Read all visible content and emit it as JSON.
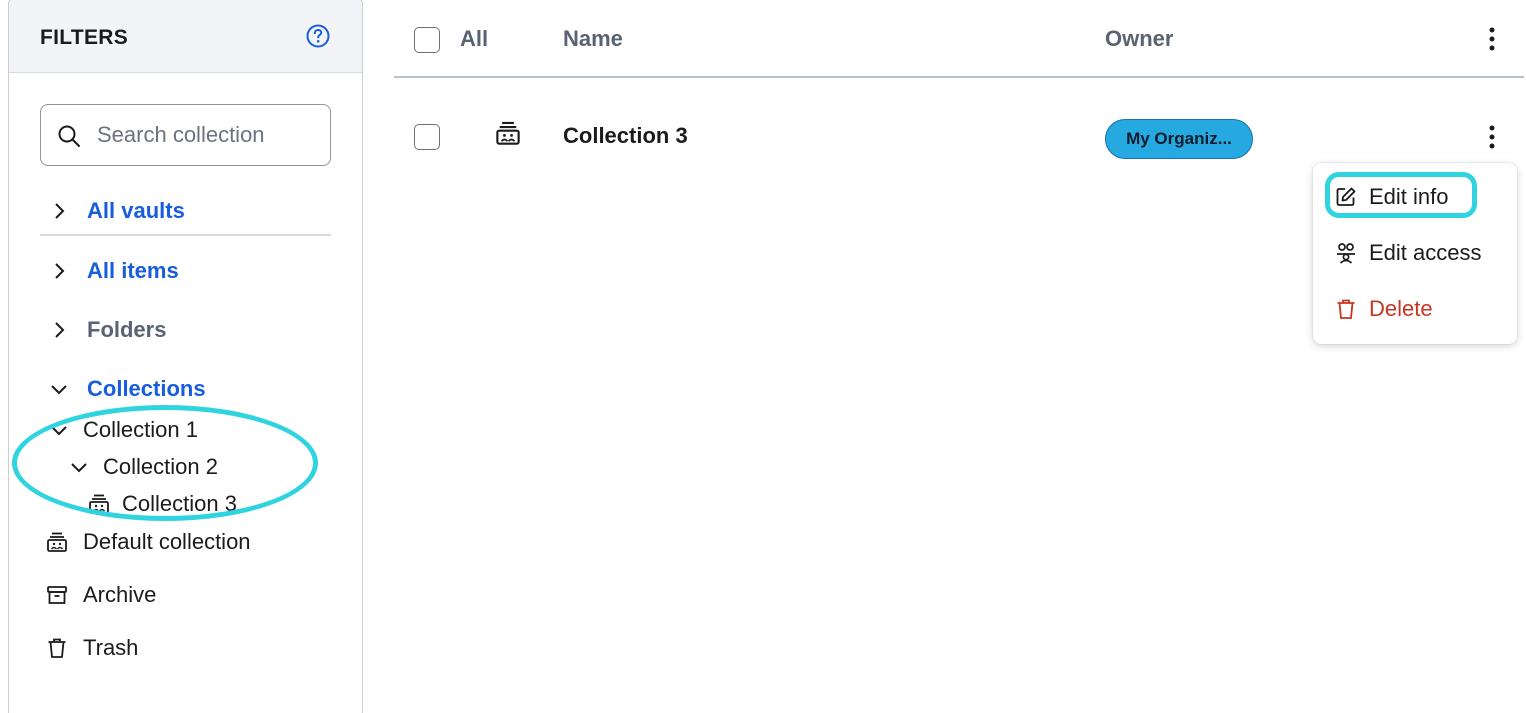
{
  "sidebar": {
    "title": "FILTERS",
    "search_placeholder": "Search collection",
    "nav": [
      {
        "label": "All vaults",
        "expanded": false
      },
      {
        "label": "All items",
        "expanded": false
      },
      {
        "label": "Folders",
        "expanded": false
      },
      {
        "label": "Collections",
        "expanded": true
      }
    ],
    "tree": [
      {
        "label": "Collection 1",
        "expanded": true
      },
      {
        "label": "Collection 2",
        "expanded": true
      },
      {
        "label": "Collection 3"
      }
    ],
    "extras": [
      {
        "label": "Default collection",
        "icon": "collection-icon"
      },
      {
        "label": "Archive",
        "icon": "archive-icon"
      },
      {
        "label": "Trash",
        "icon": "trash-icon"
      }
    ]
  },
  "table": {
    "headers": {
      "all": "All",
      "name": "Name",
      "owner": "Owner"
    },
    "rows": [
      {
        "name": "Collection 3",
        "owner": "My Organiz..."
      }
    ]
  },
  "menu": {
    "items": [
      {
        "label": "Edit info",
        "icon": "edit-icon"
      },
      {
        "label": "Edit access",
        "icon": "users-icon"
      },
      {
        "label": "Delete",
        "icon": "trash-icon"
      }
    ]
  },
  "colors": {
    "accent": "#175ddc",
    "highlight": "#30d4e0",
    "badge": "#25a9e0",
    "danger": "#c83522"
  }
}
